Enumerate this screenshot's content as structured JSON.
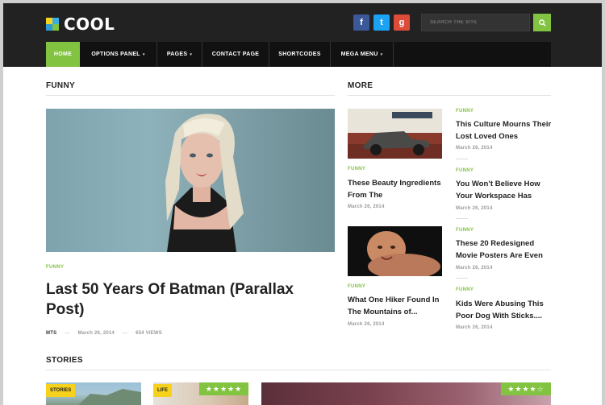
{
  "colors": {
    "accent": "#82c341",
    "dark": "#222222",
    "facebook": "#3b5998",
    "twitter": "#1da1f2",
    "googleplus": "#dd4b39",
    "badge_yellow": "#f7d21c"
  },
  "header": {
    "logo_text": "COOL",
    "social": [
      {
        "label": "f",
        "icon": "facebook-icon"
      },
      {
        "label": "t",
        "icon": "twitter-icon"
      },
      {
        "label": "g",
        "icon": "google-plus-icon"
      }
    ],
    "search": {
      "placeholder": "SEARCH THE SITE",
      "icon": "search-icon"
    }
  },
  "nav": {
    "items": [
      {
        "label": "HOME",
        "active": true,
        "caret": ""
      },
      {
        "label": "OPTIONS PANEL",
        "active": false,
        "caret": "▾"
      },
      {
        "label": "PAGES",
        "active": false,
        "caret": "▾"
      },
      {
        "label": "CONTACT PAGE",
        "active": false,
        "caret": ""
      },
      {
        "label": "SHORTCODES",
        "active": false,
        "caret": ""
      },
      {
        "label": "MEGA MENU",
        "active": false,
        "caret": "▾"
      }
    ]
  },
  "funny": {
    "title": "FUNNY",
    "featured": {
      "category": "FUNNY",
      "title": "Last 50 Years Of Batman (Parallax Post)",
      "author": "MTS",
      "date": "March 26, 2014",
      "views": "654 VIEWS"
    }
  },
  "more": {
    "title": "MORE",
    "left": [
      {
        "category": "FUNNY",
        "title": "These Beauty Ingredients From The",
        "date": "March 26, 2014"
      },
      {
        "category": "FUNNY",
        "title": "What One Hiker Found In The Mountains of...",
        "date": "March 26, 2014"
      }
    ],
    "right": [
      {
        "category": "FUNNY",
        "title": "This Culture Mourns Their Lost Loved Ones",
        "date": "March 26, 2014"
      },
      {
        "category": "FUNNY",
        "title": "You Won’t Believe How Your Workspace Has",
        "date": "March 26, 2014"
      },
      {
        "category": "FUNNY",
        "title": "These 20 Redesigned Movie Posters Are Even",
        "date": "March 26, 2014"
      },
      {
        "category": "FUNNY",
        "title": "Kids Were Abusing This Poor Dog With Sticks....",
        "date": "March 26, 2014"
      }
    ]
  },
  "stories": {
    "title": "STORIES",
    "cards": [
      {
        "badge": "STORIES",
        "stars": ""
      },
      {
        "badge": "LIFE",
        "stars": "★★★★★"
      },
      {
        "badge": "",
        "stars": "★★★★☆"
      }
    ]
  }
}
